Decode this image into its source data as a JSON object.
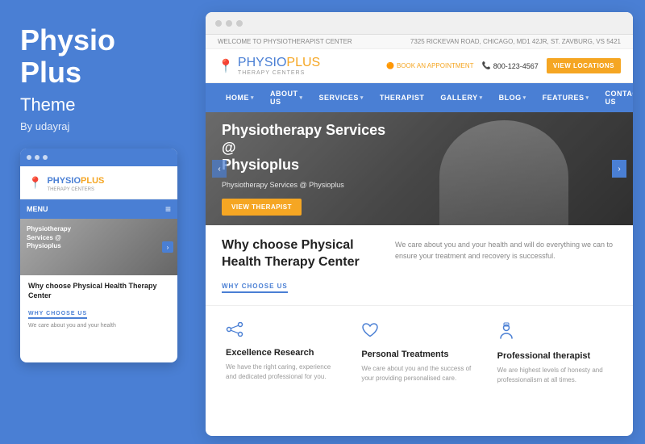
{
  "left": {
    "title_line1": "Physio",
    "title_line2": "Plus",
    "subtitle": "Theme",
    "author": "By udayraj"
  },
  "mobile": {
    "logo_physio": "PHYSIO",
    "logo_plus": "PLUS",
    "logo_sub": "THERAPY CENTERS",
    "menu": "MENU",
    "hero_text_line1": "Physiotherapy",
    "hero_text_line2": "Services @",
    "hero_text_line3": "Physioplus",
    "body_title": "Why choose Physical Health Therapy Center",
    "why_label": "WHY CHOOSE US",
    "body_text": "We care about you and your health"
  },
  "browser": {
    "topbar_welcome": "WELCOME TO PHYSIOTHERAPIST CENTER",
    "topbar_address": "7325 RICKEVAN ROAD, CHICAGO, MD1 42JR, ST. ZAVBURG, VS 5421",
    "logo_physio": "PHYSIO",
    "logo_plus": "PLUS",
    "logo_sub": "THERAPY CENTERS",
    "book_appt": "BOOK AN APPOINTMENT",
    "phone": "800-123-4567",
    "view_locations": "VIEW LOCATIONS",
    "nav": [
      "HOME",
      "ABOUT US",
      "SERVICES",
      "THERAPIST",
      "GALLERY",
      "BLOG",
      "FEATURES",
      "CONTACT US"
    ],
    "hero_title_line1": "Physiotherapy Services @",
    "hero_title_line2": "Physioplus",
    "hero_sub": "Physiotherapy Services @ Physioplus",
    "hero_btn": "VIEW THERAPIST",
    "why_title": "Why choose Physical Health Therapy Center",
    "why_label": "WHY CHOOSE US",
    "why_text": "We care about you and your health and will do everything we can to ensure your treatment and recovery is successful.",
    "features": [
      {
        "icon": "share",
        "title": "Excellence Research",
        "text": "We have the right caring, experience and dedicated professional for you."
      },
      {
        "icon": "heart",
        "title": "Personal Treatments",
        "text": "We care about you and the success of your providing personalised care."
      },
      {
        "icon": "person",
        "title": "Professional therapist",
        "text": "We are highest levels of honesty and professionalism at all times."
      }
    ]
  },
  "colors": {
    "brand_blue": "#4a7fd4",
    "brand_orange": "#f5a623"
  }
}
